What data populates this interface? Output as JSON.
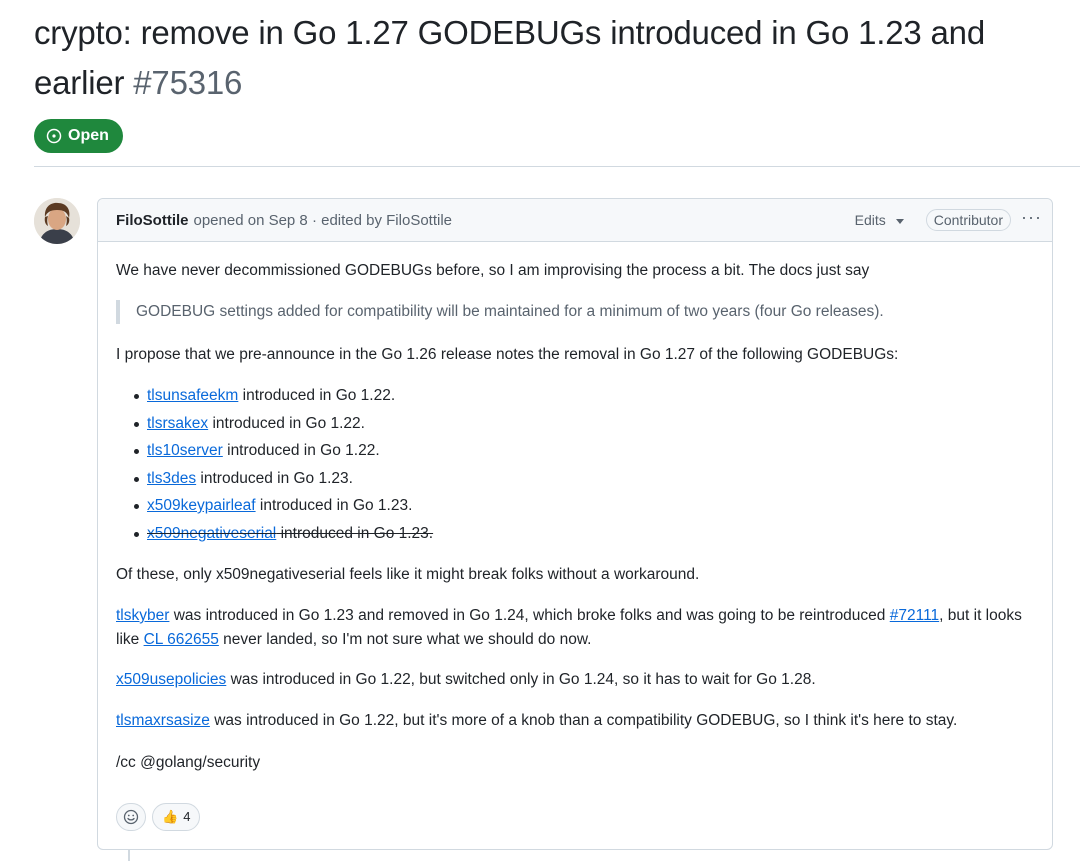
{
  "issue": {
    "title": "crypto: remove in Go 1.27 GODEBUGs introduced in Go 1.23 and earlier",
    "number": "#75316",
    "state": "Open"
  },
  "comment": {
    "author": "FiloSottile",
    "meta": "opened on Sep 8 · edited by FiloSottile",
    "edits_label": "Edits",
    "role": "Contributor",
    "more": "···",
    "p1": "We have never decommissioned GODEBUGs before, so I am improvising the process a bit. The docs just say",
    "quote": "GODEBUG settings added for compatibility will be maintained for a minimum of two years (four Go releases).",
    "p2": "I propose that we pre-announce in the Go 1.26 release notes the removal in Go 1.27 of the following GODEBUGs:",
    "godebugs": [
      {
        "name": "tlsunsafeekm",
        "text": " introduced in Go 1.22."
      },
      {
        "name": "tlsrsakex",
        "text": " introduced in Go 1.22."
      },
      {
        "name": "tls10server",
        "text": " introduced in Go 1.22."
      },
      {
        "name": "tls3des",
        "text": " introduced in Go 1.23."
      },
      {
        "name": "x509keypairleaf",
        "text": " introduced in Go 1.23."
      },
      {
        "name": "x509negativeserial",
        "text": " introduced in Go 1.23."
      }
    ],
    "p3": "Of these, only x509negativeserial feels like it might break folks without a workaround.",
    "p4": {
      "link1": "tlskyber",
      "text1": " was introduced in Go 1.23 and removed in Go 1.24, which broke folks and was going to be reintroduced ",
      "link2": "#72111",
      "text2": ", but it looks like ",
      "link3": "CL 662655",
      "text3": " never landed, so I'm not sure what we should do now."
    },
    "p5": {
      "link": "x509usepolicies",
      "text": " was introduced in Go 1.22, but switched only in Go 1.24, so it has to wait for Go 1.28."
    },
    "p6": {
      "link": "tlsmaxrsasize",
      "text": " was introduced in Go 1.22, but it's more of a knob than a compatibility GODEBUG, so I think it's here to stay."
    },
    "p7": "/cc @golang/security",
    "reactions": {
      "thumbs_up_emoji": "👍",
      "thumbs_up_count": "4"
    }
  },
  "colors": {
    "open_green": "#1f883d",
    "link_blue": "#0969da",
    "muted_text": "#59636e",
    "border": "#d1d9e0"
  }
}
